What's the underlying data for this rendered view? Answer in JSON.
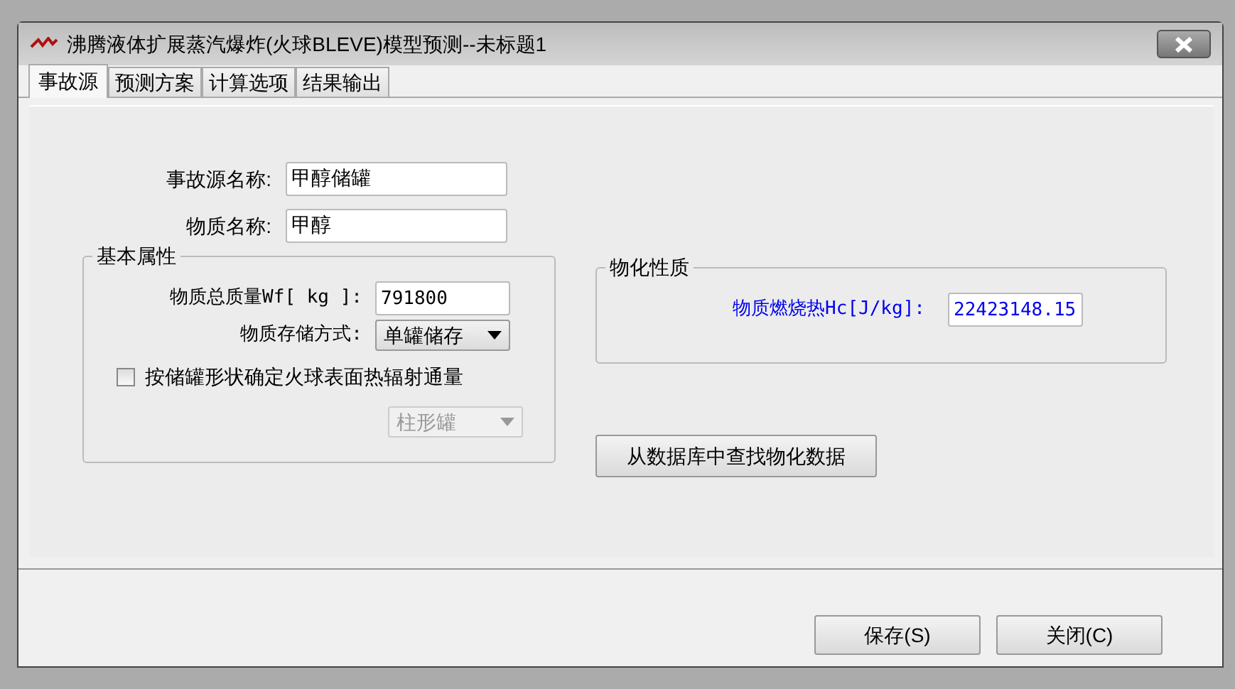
{
  "window": {
    "title": "沸腾液体扩展蒸汽爆炸(火球BLEVE)模型预测--未标题1"
  },
  "tabs": [
    {
      "label": "事故源",
      "selected": true
    },
    {
      "label": "预测方案",
      "selected": false
    },
    {
      "label": "计算选项",
      "selected": false
    },
    {
      "label": "结果输出",
      "selected": false
    }
  ],
  "source_fields": [
    {
      "kind": "text",
      "label": "事故源名称:",
      "value": "甲醇储罐"
    },
    {
      "kind": "text",
      "label": "物质名称:",
      "value": "甲醇"
    }
  ],
  "basic_properties": {
    "title": "基本属性",
    "fields": [
      {
        "kind": "text",
        "label": "物质总质量Wf[ kg ]:",
        "value": "791800"
      },
      {
        "kind": "select",
        "label": "物质存储方式:",
        "value": "单罐储存"
      }
    ],
    "checkbox": {
      "label": "按储罐形状确定火球表面热辐射通量",
      "checked": false
    },
    "shape_select": {
      "value": "柱形罐",
      "disabled": true
    }
  },
  "physchem_properties": {
    "title": "物化性质",
    "fields": [
      {
        "kind": "text",
        "label": "物质燃烧热Hc[J/kg]:",
        "value": "22423148.15",
        "highlighted": true
      }
    ]
  },
  "lookup_button": "从数据库中查找物化数据",
  "buttons": [
    "保存(S)",
    "关闭(C)"
  ]
}
